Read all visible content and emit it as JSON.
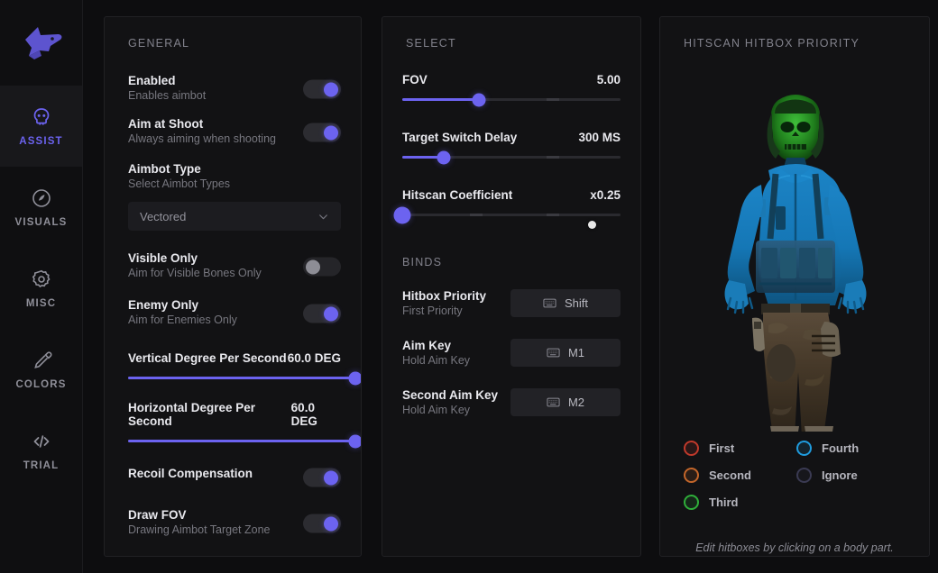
{
  "brand": {
    "logo_icon": "wolf-head-logo"
  },
  "sidebar": {
    "items": [
      {
        "label": "ASSIST",
        "icon": "skull-icon",
        "active": true
      },
      {
        "label": "VISUALS",
        "icon": "eye-moon-icon",
        "active": false
      },
      {
        "label": "MISC",
        "icon": "gear-icon",
        "active": false
      },
      {
        "label": "COLORS",
        "icon": "eyedropper-icon",
        "active": false
      },
      {
        "label": "TRIAL",
        "icon": "code-icon",
        "active": false
      }
    ]
  },
  "general": {
    "title": "GENERAL",
    "enabled": {
      "label": "Enabled",
      "desc": "Enables aimbot",
      "on": true
    },
    "aim_at_shoot": {
      "label": "Aim at Shoot",
      "desc": "Always aiming when shooting",
      "on": true
    },
    "aimbot_type": {
      "label": "Aimbot Type",
      "desc": "Select Aimbot Types",
      "value": "Vectored"
    },
    "visible_only": {
      "label": "Visible Only",
      "desc": "Aim for Visible Bones Only",
      "on": false
    },
    "enemy_only": {
      "label": "Enemy Only",
      "desc": "Aim for Enemies Only",
      "on": true
    },
    "vertical_dps": {
      "label": "Vertical Degree Per Second",
      "value": "60.0 DEG",
      "pct": 100
    },
    "horizontal_dps": {
      "label": "Horizontal Degree Per Second",
      "value": "60.0 DEG",
      "pct": 100
    },
    "recoil": {
      "label": "Recoil Compensation",
      "desc": "",
      "on": true
    },
    "draw_fov": {
      "label": "Draw FOV",
      "desc": "Drawing Aimbot Target Zone",
      "on": true
    }
  },
  "select": {
    "title": "SELECT",
    "fov": {
      "label": "FOV",
      "value": "5.00",
      "pct": 35
    },
    "switch": {
      "label": "Target Switch Delay",
      "value": "300 MS",
      "pct": 19
    },
    "hitscan": {
      "label": "Hitscan Coefficient",
      "value": "x0.25",
      "pct": 0
    }
  },
  "binds": {
    "title": "BINDS",
    "items": [
      {
        "label": "Hitbox Priority",
        "desc": "First Priority",
        "key": "Shift",
        "icon": "keyboard-icon"
      },
      {
        "label": "Aim Key",
        "desc": "Hold Aim Key",
        "key": "M1",
        "icon": "keyboard-icon"
      },
      {
        "label": "Second Aim Key",
        "desc": "Hold Aim Key",
        "key": "M2",
        "icon": "keyboard-icon"
      }
    ]
  },
  "hitbox": {
    "title": "HITSCAN HITBOX PRIORITY",
    "hint": "Edit hitboxes by clicking on a body part.",
    "legend": [
      {
        "label": "First",
        "color": "#c0392b"
      },
      {
        "label": "Fourth",
        "color": "#1f9bdd"
      },
      {
        "label": "Second",
        "color": "#c4662a"
      },
      {
        "label": "Ignore",
        "color": "#3a3a52"
      },
      {
        "label": "Third",
        "color": "#2fae3a"
      }
    ]
  },
  "theme": {
    "accent": "#6c63f0",
    "bg": "#0d0d0f",
    "card": "#121214"
  }
}
